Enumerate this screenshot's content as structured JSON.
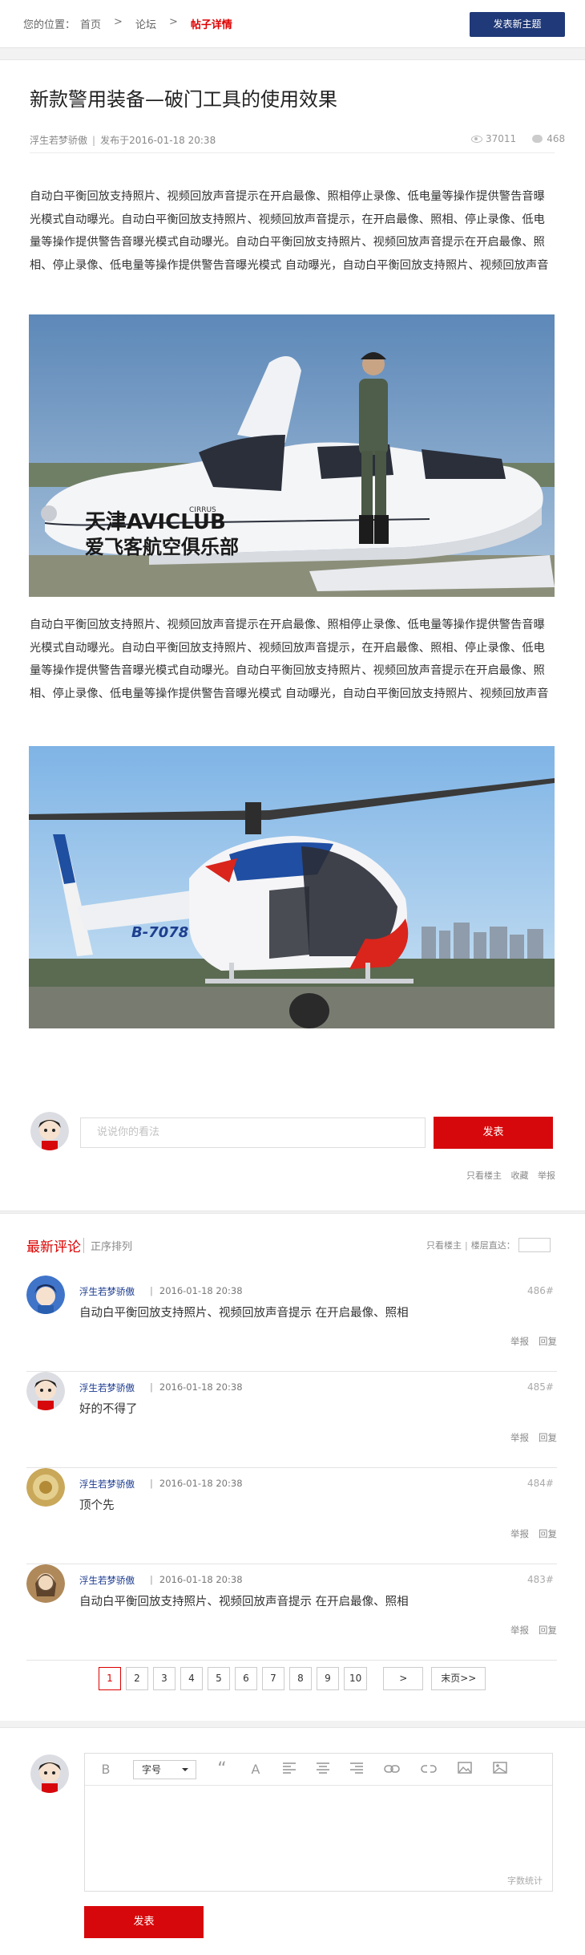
{
  "breadcrumb": {
    "label": "您的位置：",
    "items": [
      "首页",
      "论坛",
      "帖子详情"
    ],
    "separator": ">"
  },
  "header": {
    "new_topic_button": "发表新主题"
  },
  "post": {
    "title": "新款警用装备—破门工具的使用效果",
    "author": "浮生若梦骄傲",
    "meta_divider": "|",
    "published": "发布于2016-01-18 20:38",
    "views": "37011",
    "replies": "468",
    "paragraph1": "自动白平衡回放支持照片、视频回放声音提示在开启最像、照相停止录像、低电量等操作提供警告音曝光模式自动曝光。自动白平衡回放支持照片、视频回放声音提示，在开启最像、照相、停止录像、低电量等操作提供警告音曝光模式自动曝光。自动白平衡回放支持照片、视频回放声音提示在开启最像、照相、停止录像、低电量等操作提供警告音曝光模式 自动曝光，自动白平衡回放支持照片、视频回放声音提示 在开启最像、照相、停止录像、低电量等",
    "paragraph2": "自动白平衡回放支持照片、视频回放声音提示在开启最像、照相停止录像、低电量等操作提供警告音曝光模式自动曝光。自动白平衡回放支持照片、视频回放声音提示，在开启最像、照相、停止录像、低电量等操作提供警告音曝光模式自动曝光。自动白平衡回放支持照片、视频回放声音提示在开启最像、照相、停止录像、低电量等操作提供警告音曝光模式 自动曝光，自动白平衡回放支持照片、视频回放声音提示 在开启最像、照相、停止录像、低电量等",
    "image1_text": [
      "天津AVICLUB",
      "爱飞客航空俱乐部",
      "CIRRUS"
    ],
    "image2_text": "B-7078"
  },
  "reply_box": {
    "placeholder": "说说你的看法",
    "send_button": "发表",
    "actions": [
      "只看楼主",
      "收藏",
      "举报"
    ]
  },
  "comments": {
    "title": "最新评论",
    "sort_label": "正序排列",
    "only_owner": "只看楼主",
    "divider": "|",
    "goto_floor": "楼层直达：",
    "items": [
      {
        "user": "浮生若梦骄傲",
        "date": "2016-01-18 20:38",
        "floor": "486#",
        "text": "自动白平衡回放支持照片、视频回放声音提示 在开启最像、照相",
        "report": "举报",
        "reply": "回复"
      },
      {
        "user": "浮生若梦骄傲",
        "date": "2016-01-18 20:38",
        "floor": "485#",
        "text": "好的不得了",
        "report": "举报",
        "reply": "回复"
      },
      {
        "user": "浮生若梦骄傲",
        "date": "2016-01-18 20:38",
        "floor": "484#",
        "text": "顶个先",
        "report": "举报",
        "reply": "回复"
      },
      {
        "user": "浮生若梦骄傲",
        "date": "2016-01-18 20:38",
        "floor": "483#",
        "text": "自动白平衡回放支持照片、视频回放声音提示 在开启最像、照相",
        "report": "举报",
        "reply": "回复"
      }
    ]
  },
  "pagination": {
    "pages": [
      "1",
      "2",
      "3",
      "4",
      "5",
      "6",
      "7",
      "8",
      "9",
      "10"
    ],
    "current": "1",
    "next": ">",
    "last": "末页>>"
  },
  "editor": {
    "bold": "B",
    "font_size": "字号",
    "quote": "“",
    "font_color": "A",
    "word_count": "字数统计",
    "send_button": "发表"
  },
  "colors": {
    "accent_red": "#d7080b",
    "navy": "#203978",
    "user_link": "#1a3a8f"
  }
}
